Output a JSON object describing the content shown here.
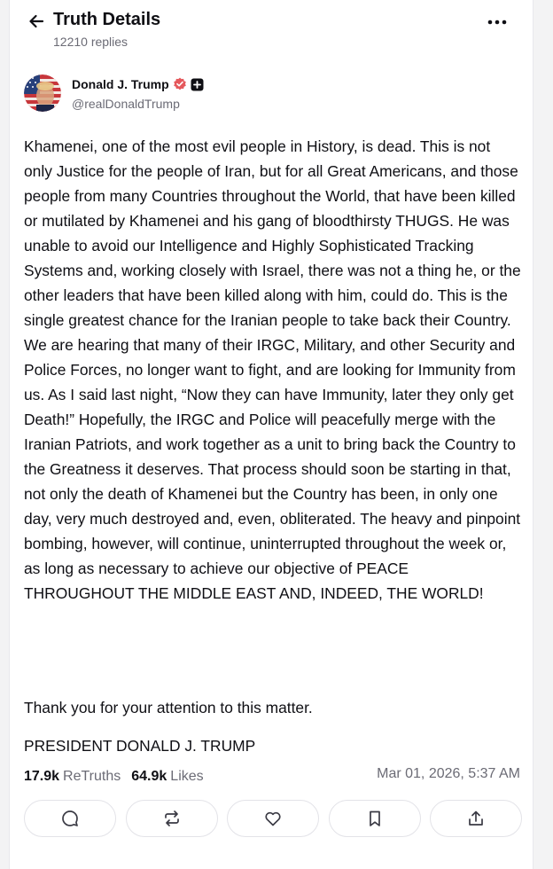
{
  "header": {
    "title": "Truth Details",
    "replies": "12210 replies",
    "back_icon": "arrow-left-icon",
    "more_icon": "more-horizontal-icon"
  },
  "author": {
    "name": "Donald J. Trump",
    "handle": "@realDonaldTrump",
    "verified_color": "#e5585c"
  },
  "post": {
    "body": "Khamenei, one of the most evil people in History, is dead. This is not only Justice for the people of Iran, but for all Great Americans, and those people from many Countries throughout the World, that have been killed or mutilated by Khamenei and his gang of bloodthirsty THUGS. He was unable to avoid our Intelligence and Highly Sophisticated Tracking Systems and, working closely with Israel, there was not a thing he, or the other leaders that have been killed along with him, could do. This is the single greatest chance for the Iranian people to take back their Country. We are hearing that many of their IRGC, Military, and other Security and Police Forces, no longer want to fight, and are looking for Immunity from us. As I said last night, “Now they can have Immunity, later they only get Death!” Hopefully, the IRGC and Police will peacefully merge with the Iranian Patriots, and work together as a unit to bring back the Country to the Greatness it deserves. That process should soon be starting in that, not only the death of Khamenei but the Country has been, in only one day, very much destroyed and, even, obliterated. The heavy and pinpoint bombing, however, will continue, uninterrupted throughout the week or, as long as necessary to achieve our objective of PEACE THROUGHOUT THE MIDDLE EAST AND, INDEED, THE WORLD!",
    "thanks": "Thank you for your attention to this matter.",
    "signature": "PRESIDENT DONALD J. TRUMP"
  },
  "stats": {
    "retruths_count": "17.9k",
    "retruths_label": "ReTruths",
    "likes_count": "64.9k",
    "likes_label": "Likes",
    "timestamp": "Mar 01, 2026, 5:37 AM"
  },
  "actions": [
    "reply-icon",
    "retruth-icon",
    "like-icon",
    "bookmark-icon",
    "share-icon"
  ]
}
